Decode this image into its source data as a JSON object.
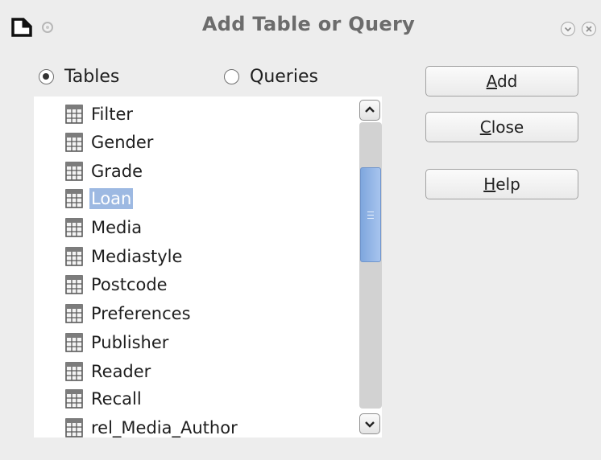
{
  "window": {
    "title": "Add Table or Query"
  },
  "source_selector": {
    "tables_label": "Tables",
    "queries_label": "Queries",
    "selected": "Tables"
  },
  "table_list": {
    "selected_item": "Loan",
    "items": [
      "Filter",
      "Gender",
      "Grade",
      "Loan",
      "Media",
      "Mediastyle",
      "Postcode",
      "Preferences",
      "Publisher",
      "Reader",
      "Recall",
      "rel_Media_Author"
    ]
  },
  "buttons": {
    "add": {
      "mnemonic": "A",
      "rest": "dd"
    },
    "close": {
      "mnemonic": "C",
      "rest": "lose"
    },
    "help": {
      "mnemonic": "H",
      "rest": "elp"
    }
  },
  "colors": {
    "selection": "#9db9e2",
    "scroll_thumb": "#8fb2e4",
    "dialog_bg": "#ededed"
  },
  "icons": {
    "app": "document-icon",
    "table": "table-icon",
    "minimize": "chevron-down-icon",
    "close": "close-icon"
  }
}
